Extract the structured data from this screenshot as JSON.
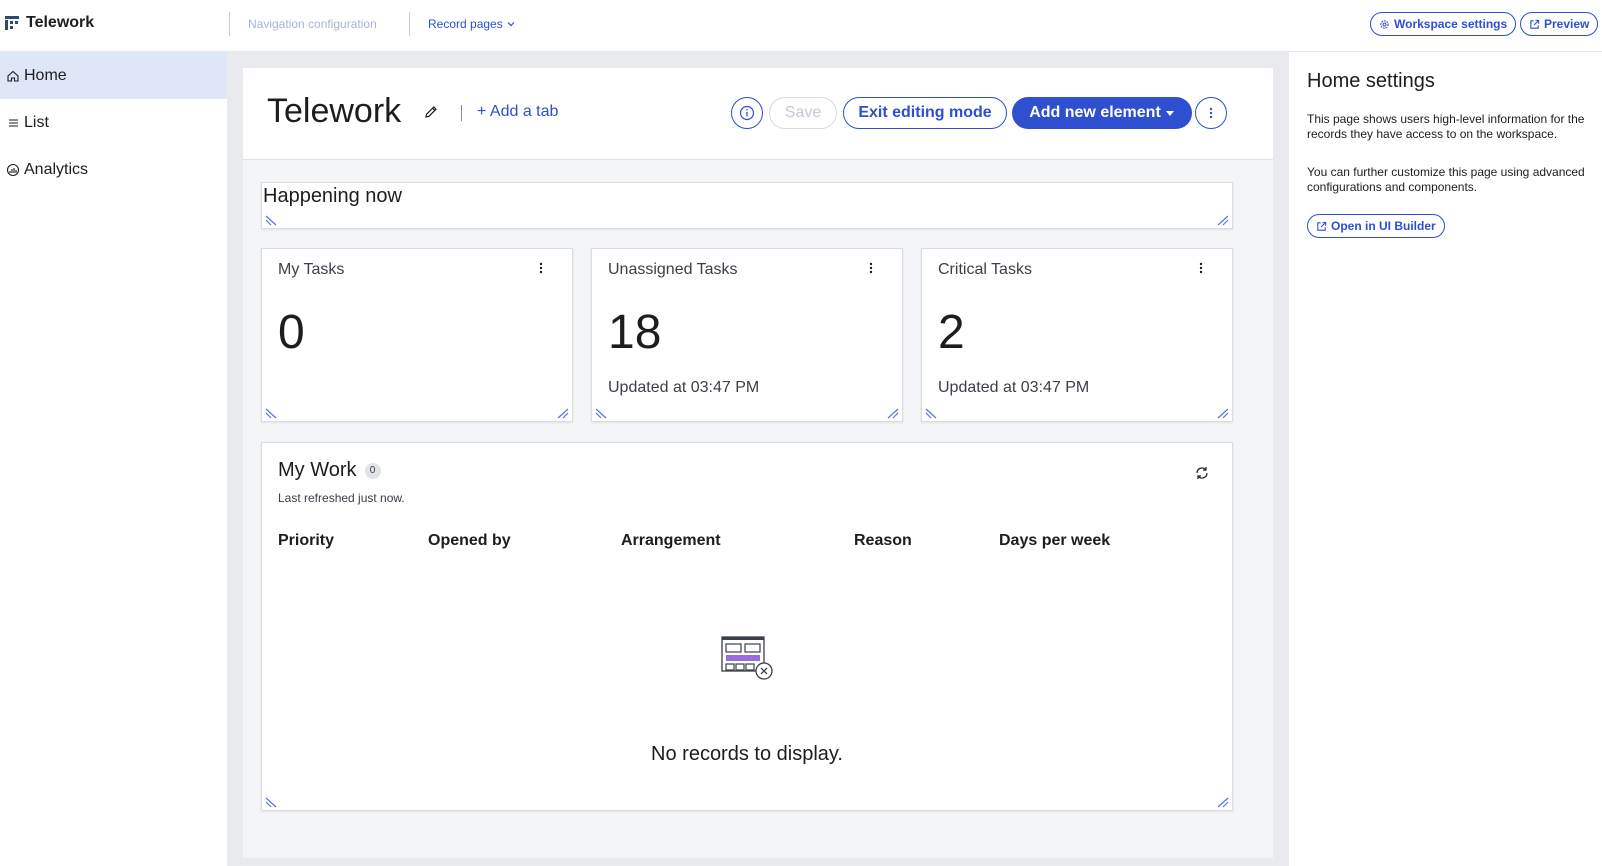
{
  "topbar": {
    "app_name": "Telework",
    "nav_config": "Navigation configuration",
    "record_pages": "Record pages",
    "workspace_settings": "Workspace settings",
    "preview": "Preview"
  },
  "sidebar": {
    "items": [
      {
        "label": "Home",
        "icon": "home-icon",
        "active": true
      },
      {
        "label": "List",
        "icon": "list-icon",
        "active": false
      },
      {
        "label": "Analytics",
        "icon": "analytics-icon",
        "active": false
      }
    ]
  },
  "editor": {
    "title": "Telework",
    "add_tab": "Add a tab",
    "save": "Save",
    "exit_editing": "Exit editing mode",
    "add_new_element": "Add new element"
  },
  "happening": {
    "title": "Happening now"
  },
  "kpis": [
    {
      "title": "My Tasks",
      "value": "0",
      "updated": ""
    },
    {
      "title": "Unassigned Tasks",
      "value": "18",
      "updated": "Updated at 03:47 PM"
    },
    {
      "title": "Critical Tasks",
      "value": "2",
      "updated": "Updated at 03:47 PM"
    }
  ],
  "my_work": {
    "title": "My Work",
    "count": "0",
    "subtitle": "Last refreshed just now.",
    "columns": [
      "Priority",
      "Opened by",
      "Arrangement",
      "Reason",
      "Days per week"
    ],
    "empty_text": "No records to display."
  },
  "right_panel": {
    "title": "Home settings",
    "text1": "This page shows users high-level information for the records they have access to on the workspace.",
    "text2": "You can further customize this page using advanced configurations and components.",
    "open_builder": "Open in UI Builder"
  },
  "colors": {
    "accent": "#2e4fcf",
    "active_nav": "#dfe6f7",
    "canvas_bg": "#e9eaed"
  }
}
